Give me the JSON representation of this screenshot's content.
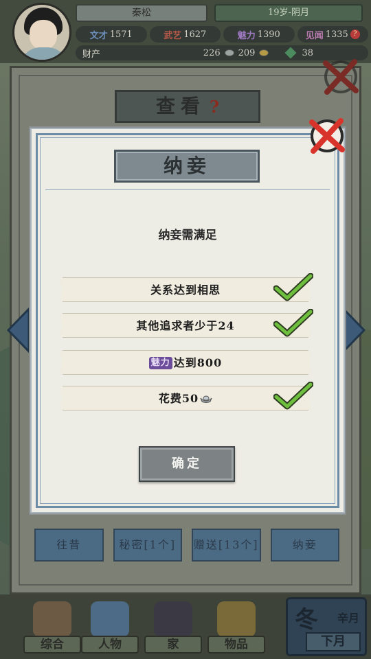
{
  "player": {
    "name": "秦松",
    "age_info": "19岁-阴月"
  },
  "stats": [
    {
      "key": "文才",
      "value": "1571",
      "cls": "k-wencai"
    },
    {
      "key": "武艺",
      "value": "1627",
      "cls": "k-wuyi"
    },
    {
      "key": "魅力",
      "value": "1390",
      "cls": "k-meili"
    },
    {
      "key": "见闻",
      "value": "1335",
      "cls": "k-jianwen"
    }
  ],
  "assets": {
    "label": "财产",
    "silver": "226",
    "gold": "209",
    "gems": "38"
  },
  "outer_panel": {
    "title": "查看",
    "help": "?",
    "tabs": [
      "往昔",
      "秘密[1个]",
      "赠送[13个]",
      "纳妾"
    ]
  },
  "dialog": {
    "title": "纳妾",
    "subtitle": "纳妾需满足",
    "requirements": [
      {
        "text": "关系达到相思",
        "met": true
      },
      {
        "text": "其他追求者少于24",
        "met": true
      },
      {
        "tag": "魅力",
        "text": "达到800",
        "met": false
      },
      {
        "text": "花费50",
        "met": true
      }
    ],
    "confirm_label": "确定"
  },
  "bottom_nav": {
    "items": [
      "综合",
      "人物",
      "家",
      "物品"
    ],
    "season": "冬",
    "month": "辛月",
    "next_label": "下月"
  },
  "colors": {
    "check_green": "#5aa83a",
    "close_red": "#d9342b",
    "meili_purple": "#6c4d9c",
    "frame_blue": "#6d8ba5"
  }
}
